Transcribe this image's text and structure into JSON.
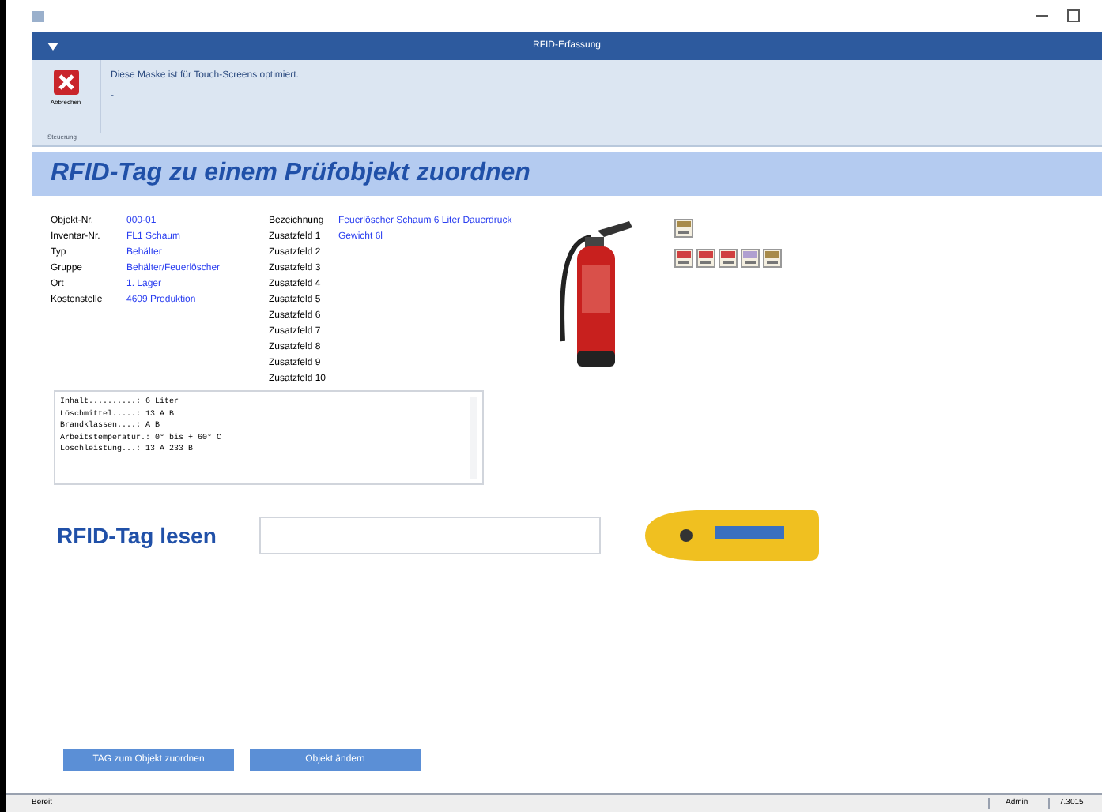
{
  "window": {
    "title": "RFID-Erfassung"
  },
  "ribbon": {
    "button": "Abbrechen",
    "group": "Steuerung",
    "message": "Diese Maske ist für Touch-Screens optimiert.",
    "message_2": "-"
  },
  "heading": "RFID-Tag zu einem Prüfobjekt zuordnen",
  "fields_left": [
    {
      "label": "Objekt-Nr.",
      "value": "000-01"
    },
    {
      "label": "Inventar-Nr.",
      "value": "FL1 Schaum"
    },
    {
      "label": "Typ",
      "value": "Behälter"
    },
    {
      "label": "Gruppe",
      "value": "Behälter/Feuerlöscher"
    },
    {
      "label": "Ort",
      "value": "1. Lager"
    },
    {
      "label": "Kostenstelle",
      "value": "4609 Produktion"
    }
  ],
  "fields_right": [
    {
      "label": "Bezeichnung",
      "value": "Feuerlöscher Schaum 6 Liter Dauerdruck"
    },
    {
      "label": "Zusatzfeld 1",
      "value": "Gewicht 6l"
    },
    {
      "label": "Zusatzfeld 2"
    },
    {
      "label": "Zusatzfeld 3"
    },
    {
      "label": "Zusatzfeld 4"
    },
    {
      "label": "Zusatzfeld 5"
    },
    {
      "label": "Zusatzfeld 6"
    },
    {
      "label": "Zusatzfeld 7"
    },
    {
      "label": "Zusatzfeld 8"
    },
    {
      "label": "Zusatzfeld 9"
    },
    {
      "label": "Zusatzfeld 10"
    }
  ],
  "details": [
    "Inhalt..........: 6 Liter",
    "Löschmittel.....: 13 A B",
    "Brandklassen....: A B",
    "Arbeitstemperatur.: 0° bis + 60° C",
    "Löschleistung...: 13 A 233 B"
  ],
  "rfid": {
    "label": "RFID-Tag lesen"
  },
  "buttons": [
    "TAG zum Objekt zuordnen",
    "Objekt ändern"
  ],
  "status_bar": {
    "text": "Bereit",
    "user": "Admin",
    "version": "7.3015"
  }
}
